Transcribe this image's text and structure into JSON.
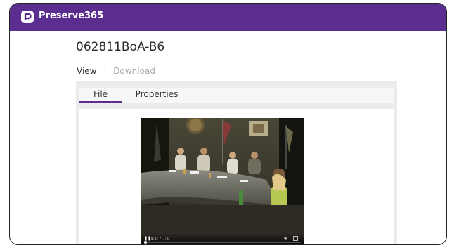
{
  "app": {
    "title": "Preserve365",
    "brand_color": "#5b2d8e",
    "logo_icon": "preserve-logo-icon"
  },
  "document": {
    "title": "062811BoA-B6"
  },
  "actions": {
    "view_label": "View",
    "separator": "|",
    "download_label": "Download"
  },
  "tabs": [
    {
      "label": "File",
      "active": true
    },
    {
      "label": "Properties",
      "active": false
    }
  ],
  "video": {
    "time": "0:02 / 1:02",
    "controls": [
      "pause-icon",
      "volume-icon",
      "fullscreen-icon"
    ]
  }
}
